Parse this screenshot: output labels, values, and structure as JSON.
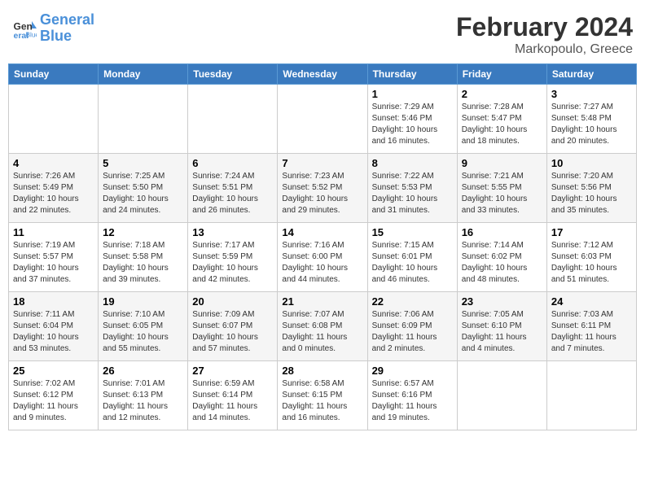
{
  "header": {
    "logo_line1": "General",
    "logo_line2": "Blue",
    "month_year": "February 2024",
    "location": "Markopoulo, Greece"
  },
  "days_of_week": [
    "Sunday",
    "Monday",
    "Tuesday",
    "Wednesday",
    "Thursday",
    "Friday",
    "Saturday"
  ],
  "weeks": [
    [
      {
        "day": "",
        "info": ""
      },
      {
        "day": "",
        "info": ""
      },
      {
        "day": "",
        "info": ""
      },
      {
        "day": "",
        "info": ""
      },
      {
        "day": "1",
        "info": "Sunrise: 7:29 AM\nSunset: 5:46 PM\nDaylight: 10 hours\nand 16 minutes."
      },
      {
        "day": "2",
        "info": "Sunrise: 7:28 AM\nSunset: 5:47 PM\nDaylight: 10 hours\nand 18 minutes."
      },
      {
        "day": "3",
        "info": "Sunrise: 7:27 AM\nSunset: 5:48 PM\nDaylight: 10 hours\nand 20 minutes."
      }
    ],
    [
      {
        "day": "4",
        "info": "Sunrise: 7:26 AM\nSunset: 5:49 PM\nDaylight: 10 hours\nand 22 minutes."
      },
      {
        "day": "5",
        "info": "Sunrise: 7:25 AM\nSunset: 5:50 PM\nDaylight: 10 hours\nand 24 minutes."
      },
      {
        "day": "6",
        "info": "Sunrise: 7:24 AM\nSunset: 5:51 PM\nDaylight: 10 hours\nand 26 minutes."
      },
      {
        "day": "7",
        "info": "Sunrise: 7:23 AM\nSunset: 5:52 PM\nDaylight: 10 hours\nand 29 minutes."
      },
      {
        "day": "8",
        "info": "Sunrise: 7:22 AM\nSunset: 5:53 PM\nDaylight: 10 hours\nand 31 minutes."
      },
      {
        "day": "9",
        "info": "Sunrise: 7:21 AM\nSunset: 5:55 PM\nDaylight: 10 hours\nand 33 minutes."
      },
      {
        "day": "10",
        "info": "Sunrise: 7:20 AM\nSunset: 5:56 PM\nDaylight: 10 hours\nand 35 minutes."
      }
    ],
    [
      {
        "day": "11",
        "info": "Sunrise: 7:19 AM\nSunset: 5:57 PM\nDaylight: 10 hours\nand 37 minutes."
      },
      {
        "day": "12",
        "info": "Sunrise: 7:18 AM\nSunset: 5:58 PM\nDaylight: 10 hours\nand 39 minutes."
      },
      {
        "day": "13",
        "info": "Sunrise: 7:17 AM\nSunset: 5:59 PM\nDaylight: 10 hours\nand 42 minutes."
      },
      {
        "day": "14",
        "info": "Sunrise: 7:16 AM\nSunset: 6:00 PM\nDaylight: 10 hours\nand 44 minutes."
      },
      {
        "day": "15",
        "info": "Sunrise: 7:15 AM\nSunset: 6:01 PM\nDaylight: 10 hours\nand 46 minutes."
      },
      {
        "day": "16",
        "info": "Sunrise: 7:14 AM\nSunset: 6:02 PM\nDaylight: 10 hours\nand 48 minutes."
      },
      {
        "day": "17",
        "info": "Sunrise: 7:12 AM\nSunset: 6:03 PM\nDaylight: 10 hours\nand 51 minutes."
      }
    ],
    [
      {
        "day": "18",
        "info": "Sunrise: 7:11 AM\nSunset: 6:04 PM\nDaylight: 10 hours\nand 53 minutes."
      },
      {
        "day": "19",
        "info": "Sunrise: 7:10 AM\nSunset: 6:05 PM\nDaylight: 10 hours\nand 55 minutes."
      },
      {
        "day": "20",
        "info": "Sunrise: 7:09 AM\nSunset: 6:07 PM\nDaylight: 10 hours\nand 57 minutes."
      },
      {
        "day": "21",
        "info": "Sunrise: 7:07 AM\nSunset: 6:08 PM\nDaylight: 11 hours\nand 0 minutes."
      },
      {
        "day": "22",
        "info": "Sunrise: 7:06 AM\nSunset: 6:09 PM\nDaylight: 11 hours\nand 2 minutes."
      },
      {
        "day": "23",
        "info": "Sunrise: 7:05 AM\nSunset: 6:10 PM\nDaylight: 11 hours\nand 4 minutes."
      },
      {
        "day": "24",
        "info": "Sunrise: 7:03 AM\nSunset: 6:11 PM\nDaylight: 11 hours\nand 7 minutes."
      }
    ],
    [
      {
        "day": "25",
        "info": "Sunrise: 7:02 AM\nSunset: 6:12 PM\nDaylight: 11 hours\nand 9 minutes."
      },
      {
        "day": "26",
        "info": "Sunrise: 7:01 AM\nSunset: 6:13 PM\nDaylight: 11 hours\nand 12 minutes."
      },
      {
        "day": "27",
        "info": "Sunrise: 6:59 AM\nSunset: 6:14 PM\nDaylight: 11 hours\nand 14 minutes."
      },
      {
        "day": "28",
        "info": "Sunrise: 6:58 AM\nSunset: 6:15 PM\nDaylight: 11 hours\nand 16 minutes."
      },
      {
        "day": "29",
        "info": "Sunrise: 6:57 AM\nSunset: 6:16 PM\nDaylight: 11 hours\nand 19 minutes."
      },
      {
        "day": "",
        "info": ""
      },
      {
        "day": "",
        "info": ""
      }
    ]
  ]
}
